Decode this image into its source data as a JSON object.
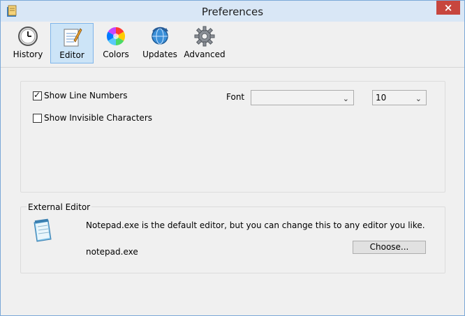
{
  "window": {
    "title": "Preferences",
    "close_symbol": "×"
  },
  "toolbar": {
    "items": [
      {
        "label": "History",
        "icon": "clock-icon"
      },
      {
        "label": "Editor",
        "icon": "notepad-pencil-icon"
      },
      {
        "label": "Colors",
        "icon": "color-wheel-icon"
      },
      {
        "label": "Updates",
        "icon": "globe-refresh-icon"
      },
      {
        "label": "Advanced",
        "icon": "gear-icon"
      }
    ],
    "active": "Editor"
  },
  "editor": {
    "show_line_numbers": {
      "label": "Show Line Numbers",
      "checked": true
    },
    "show_invisible_characters": {
      "label": "Show Invisible Characters",
      "checked": false
    },
    "font_label": "Font",
    "font_value": "",
    "font_size_value": "10"
  },
  "external_editor": {
    "title": "External Editor",
    "description": "Notepad.exe is the default editor, but you can change this to any editor you like.",
    "current_editor": "notepad.exe",
    "choose_label": "Choose..."
  },
  "colors": {
    "title_bar": "#d9e7f6",
    "active_tab": "#cce4f7",
    "close_button": "#c7463e"
  }
}
